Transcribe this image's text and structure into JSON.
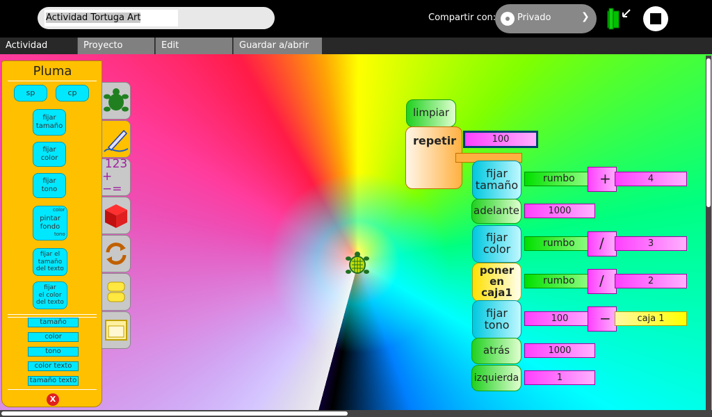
{
  "toolbar": {
    "title": "Actividad Tortuga Art",
    "share_label": "Compartir con:",
    "share_value": "Privado"
  },
  "tabs": [
    "Actividad",
    "Proyecto",
    "Edit",
    "Guardar a/abrir de"
  ],
  "palette": {
    "title": "Pluma",
    "top_blocks": [
      "sp",
      "cp"
    ],
    "blocks": [
      "fijar\ntamaño",
      "fijar\ncolor",
      "fijar\ntono",
      "pintar\nfondo",
      "fijar el\ntamaño\ndel texto",
      "fijar\nel color\ndel texto"
    ],
    "pintar_small": [
      "color",
      "tono"
    ],
    "sensors": [
      "tamaño",
      "color",
      "tono",
      "color texto",
      "tamaño texto"
    ],
    "close": "X"
  },
  "categories": [
    "turtle",
    "pen",
    "numbers",
    "flow",
    "boxes",
    "blocks",
    "media"
  ],
  "category_numbers": {
    "top": "123",
    "bottom": "+−="
  },
  "program": {
    "limpiar": "limpiar",
    "repetir": "repetir",
    "repetir_count": "100",
    "fijar_tamano": "fijar\ntamaño",
    "fijar_tamano_arg": "rumbo",
    "fijar_tamano_op": "+",
    "fijar_tamano_num": "4",
    "adelante": "adelante",
    "adelante_num": "1000",
    "fijar_color": "fijar\ncolor",
    "fijar_color_arg": "rumbo",
    "fijar_color_op": "/",
    "fijar_color_num": "3",
    "poner_caja": "poner\nen\ncaja1",
    "poner_caja_arg": "rumbo",
    "poner_caja_op": "/",
    "poner_caja_num": "2",
    "fijar_tono": "fijar\ntono",
    "fijar_tono_num": "100",
    "fijar_tono_op": "−",
    "fijar_tono_box": "caja 1",
    "atras": "atrás",
    "atras_num": "1000",
    "izquierda": "izquierda",
    "izquierda_num": "1"
  }
}
